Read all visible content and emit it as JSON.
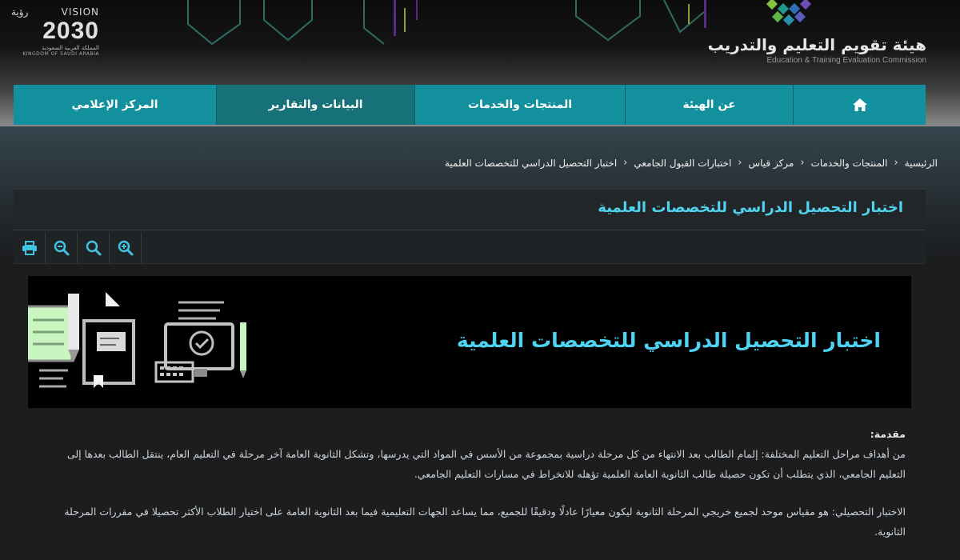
{
  "header": {
    "vision": {
      "word_en": "VISION",
      "word_ar": "رؤية",
      "year": "2030",
      "kingdom_ar": "المملكة العربية السعودية",
      "kingdom_en": "KINGDOM OF SAUDI ARABIA"
    },
    "logo": {
      "name_ar": "هيئة تقويم التعليم والتدريب",
      "name_en": "Education & Training Evaluation Commission"
    }
  },
  "nav": {
    "home_icon": "home-icon",
    "items": [
      {
        "label": "عن الهيئة"
      },
      {
        "label": "المنتجات والخدمات"
      },
      {
        "label": "البيانات والتقارير"
      },
      {
        "label": "المركز الإعلامي"
      }
    ]
  },
  "breadcrumb": [
    "الرئيسية",
    "المنتجات والخدمات",
    "مركز قياس",
    "اختبارات القبول الجامعي",
    "اختبار التحصيل الدراسي للتخصصات العلمية"
  ],
  "page_title": "اختبار التحصيل الدراسي للتخصصات العلمية",
  "toolbar": {
    "icons": [
      "zoom-in-icon",
      "search-icon",
      "zoom-out-icon",
      "print-icon"
    ]
  },
  "banner": {
    "title": "اختبار التحصيل الدراسي للتخصصات العلمية"
  },
  "content": {
    "intro_label": "مقدمة:",
    "intro_text": "من أهداف مراحل التعليم المختلفة: إلمام الطالب بعد الانتهاء من كل مرحلة دراسية بمجموعة من الأسس في المواد التي يدرسها، وتشكل الثانوية العامة آخر مرحلة في التعليم العام، ينتقل الطالب بعدها إلى التعليم الجامعي، الذي يتطلب أن تكون حصيلة طالب الثانوية العامة العلمية تؤهله للانخراط في مسارات التعليم الجامعي.",
    "test_text": "الاختبار التحصيلي: هو مقياس موحد لجميع خريجي المرحلة الثانوية ليكون معيارًا عادلًا ودقيقًا للجميع، مما يساعد الجهات التعليمية فيما بعد الثانوية العامة على اختيار الطلاب الأكثر تحصيلا في مقررات المرحلة الثانوية."
  },
  "colors": {
    "nav_bg": "#13909e",
    "nav_dark": "#167179",
    "accent": "#4fd4f0",
    "page_bg": "#1b1d1f"
  }
}
